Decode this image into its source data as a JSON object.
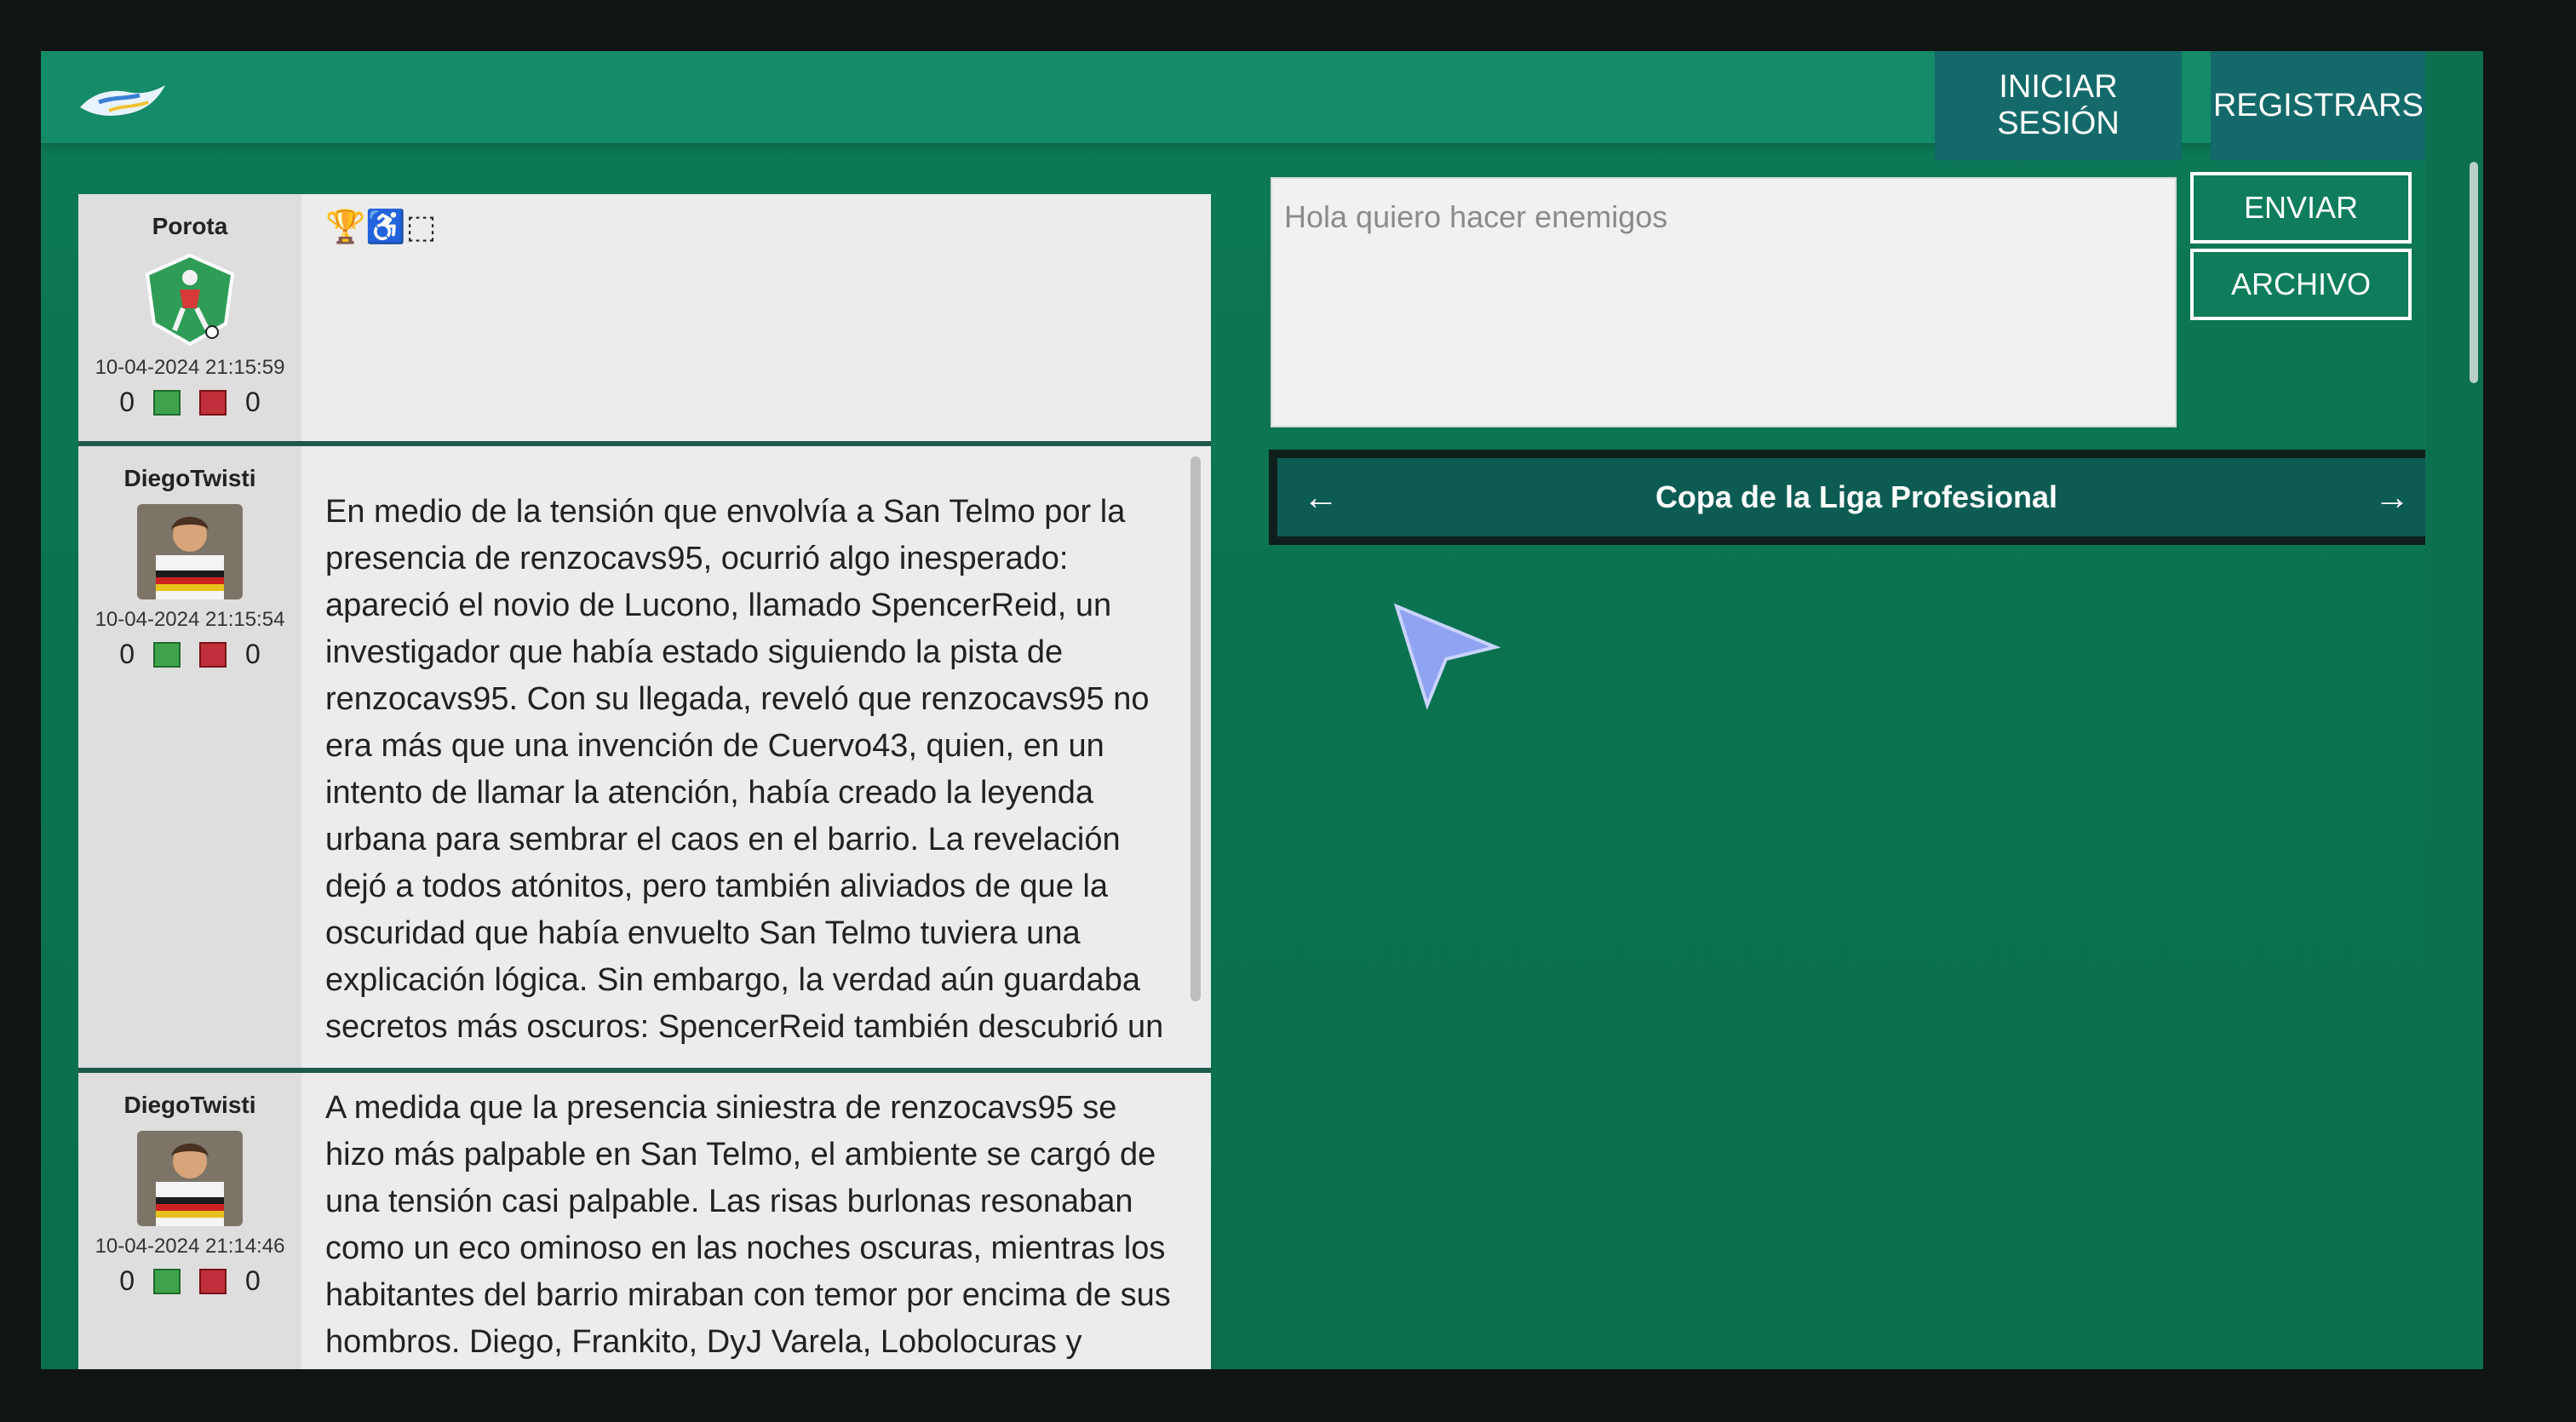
{
  "header": {
    "login_label": "INICIAR SESIÓN",
    "register_label": "REGISTRARSE"
  },
  "compose": {
    "placeholder": "Hola quiero hacer enemigos",
    "send_label": "ENVIAR",
    "file_label": "ARCHIVO"
  },
  "league": {
    "title": "Copa de la Liga Profesional",
    "prev_icon": "arrow-left-icon",
    "next_icon": "arrow-right-icon"
  },
  "posts": [
    {
      "user": "Porota",
      "date": "10-04-2024 21:15:59",
      "upvotes": "0",
      "downvotes": "0",
      "body": "",
      "emoji_text": "🏆♿⬚"
    },
    {
      "user": "DiegoTwisti",
      "date": "10-04-2024 21:15:54",
      "upvotes": "0",
      "downvotes": "0",
      "body": "En medio de la tensión que envolvía a San Telmo por la presencia de renzocavs95, ocurrió algo inesperado: apareció el novio de Lucono, llamado SpencerReid, un investigador que había estado siguiendo la pista de renzocavs95. Con su llegada, reveló que renzocavs95 no era más que una invención de Cuervo43, quien, en un intento de llamar la atención, había creado la leyenda urbana para sembrar el caos en el barrio. La revelación dejó a todos atónitos, pero también aliviados de que la oscuridad que había envuelto San Telmo tuviera una explicación lógica. Sin embargo, la verdad aún guardaba secretos más oscuros: SpencerReid también descubrió un"
    },
    {
      "user": "DiegoTwisti",
      "date": "10-04-2024 21:14:46",
      "upvotes": "0",
      "downvotes": "0",
      "body": "A medida que la presencia siniestra de renzocavs95 se hizo más palpable en San Telmo, el ambiente se cargó de una tensión casi palpable. Las risas burlonas resonaban como un eco ominoso en las noches oscuras, mientras los habitantes del barrio miraban con temor por encima de sus hombros. Diego, Frankito, DyJ Varela, Lobolocuras y"
    }
  ],
  "colors": {
    "background": "#0b7351",
    "topbar": "#138c67",
    "button": "#146a6a",
    "league_bar": "#0d5c54"
  }
}
